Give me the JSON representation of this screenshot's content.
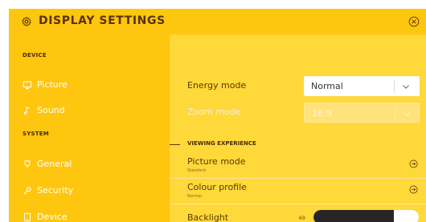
{
  "window": {
    "title": "DISPLAY SETTINGS"
  },
  "sidebar": {
    "sections": [
      {
        "header": "DEVICE",
        "items": [
          {
            "label": "Picture",
            "icon": "monitor-icon"
          },
          {
            "label": "Sound",
            "icon": "music-note-icon"
          }
        ]
      },
      {
        "header": "SYSTEM",
        "items": [
          {
            "label": "General",
            "icon": "plug-icon"
          },
          {
            "label": "Security",
            "icon": "key-icon"
          },
          {
            "label": "Device",
            "icon": "device-icon"
          }
        ]
      }
    ]
  },
  "main": {
    "energy_mode": {
      "label": "Energy mode",
      "value": "Normal"
    },
    "zoom_mode": {
      "label": "Zoom mode",
      "value": "16:9"
    },
    "viewing_experience": {
      "header": "VIEWING EXPERIENCE",
      "picture_mode": {
        "title": "Picture mode",
        "subtitle": "Standard"
      },
      "colour_profile": {
        "title": "Colour profile",
        "subtitle": "Normal"
      },
      "backlight": {
        "label": "Backlight",
        "value": "69",
        "level_percent": 76
      }
    }
  },
  "colors": {
    "title_bar": "#ffc60f",
    "sidebar": "#ffc60f",
    "content": "#ffd83a",
    "heading_text": "#5a3200",
    "slider_fill": "#262626"
  }
}
